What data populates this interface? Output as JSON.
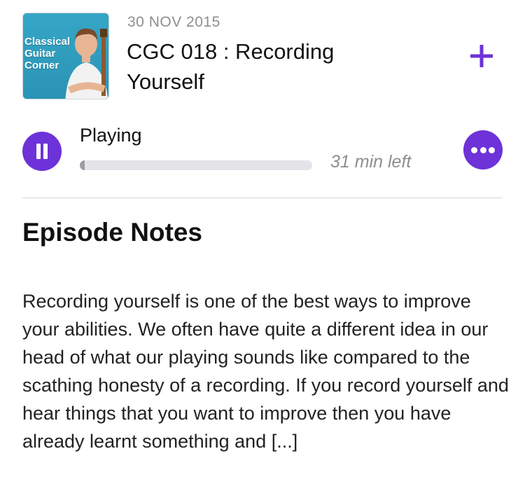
{
  "episode": {
    "artwork_text": [
      "Classical",
      "Guitar",
      "Corner"
    ],
    "date": "30 NOV 2015",
    "title": "CGC 018 : Recording Yourself"
  },
  "player": {
    "status": "Playing",
    "time_left": "31 min left",
    "progress_fraction": 0.02
  },
  "notes": {
    "heading": "Episode Notes",
    "body": "Recording yourself is one of the best ways to improve your abilities. We often have quite a different idea in our head of what our playing sounds like compared to the scathing honesty of a recording. If you record yourself and hear things that you want to improve then you have already learnt something and [...]"
  },
  "icons": {
    "add": "plus-icon",
    "pause": "pause-icon",
    "more": "ellipsis-icon"
  },
  "colors": {
    "accent": "#6d32d8",
    "secondary_text": "#8e8e93",
    "track": "#e3e3e8"
  }
}
